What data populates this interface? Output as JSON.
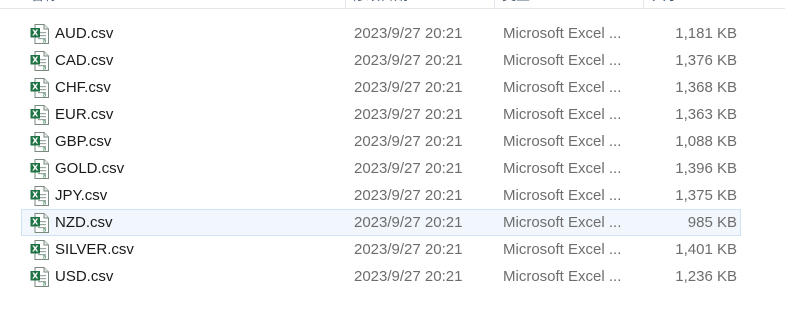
{
  "header": {
    "columns": [
      "名称",
      "修改日期",
      "类型",
      "大小"
    ]
  },
  "files": [
    {
      "name": "AUD.csv",
      "date": "2023/9/27 20:21",
      "type": "Microsoft Excel ...",
      "size": "1,181 KB"
    },
    {
      "name": "CAD.csv",
      "date": "2023/9/27 20:21",
      "type": "Microsoft Excel ...",
      "size": "1,376 KB"
    },
    {
      "name": "CHF.csv",
      "date": "2023/9/27 20:21",
      "type": "Microsoft Excel ...",
      "size": "1,368 KB"
    },
    {
      "name": "EUR.csv",
      "date": "2023/9/27 20:21",
      "type": "Microsoft Excel ...",
      "size": "1,363 KB"
    },
    {
      "name": "GBP.csv",
      "date": "2023/9/27 20:21",
      "type": "Microsoft Excel ...",
      "size": "1,088 KB"
    },
    {
      "name": "GOLD.csv",
      "date": "2023/9/27 20:21",
      "type": "Microsoft Excel ...",
      "size": "1,396 KB"
    },
    {
      "name": "JPY.csv",
      "date": "2023/9/27 20:21",
      "type": "Microsoft Excel ...",
      "size": "1,375 KB"
    },
    {
      "name": "NZD.csv",
      "date": "2023/9/27 20:21",
      "type": "Microsoft Excel ...",
      "size": "985 KB"
    },
    {
      "name": "SILVER.csv",
      "date": "2023/9/27 20:21",
      "type": "Microsoft Excel ...",
      "size": "1,401 KB"
    },
    {
      "name": "USD.csv",
      "date": "2023/9/27 20:21",
      "type": "Microsoft Excel ...",
      "size": "1,236 KB"
    }
  ],
  "hovered_row": 7,
  "icon": "excel-csv-file-icon",
  "colors": {
    "excel_green": "#1f7244",
    "hover_bg": "#f2f7fd",
    "hover_border": "#cfe1f5"
  }
}
